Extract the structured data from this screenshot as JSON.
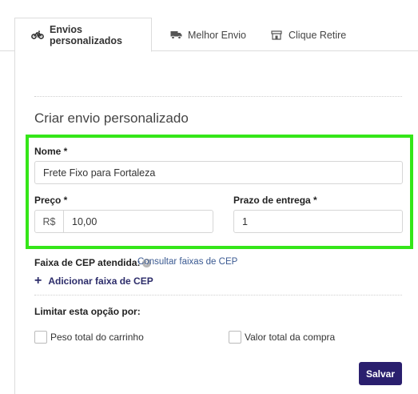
{
  "tabs": [
    {
      "label": "Envios personalizados",
      "icon": "motorcycle-icon",
      "active": true
    },
    {
      "label": "Melhor Envio",
      "icon": "truck-icon",
      "active": false
    },
    {
      "label": "Clique Retire",
      "icon": "store-icon",
      "active": false
    }
  ],
  "form": {
    "title": "Criar envio personalizado",
    "nome_label": "Nome *",
    "nome_value": "Frete Fixo para Fortaleza",
    "preco_label": "Preço *",
    "preco_prefix": "R$",
    "preco_value": "10,00",
    "prazo_label": "Prazo de entrega *",
    "prazo_value": "1",
    "cep_label": "Faixa de CEP atendida:",
    "cep_link": "Consultar faixas de CEP",
    "add_cep": "Adicionar faixa de CEP",
    "limitar_label": "Limitar esta opção por:",
    "peso_label": "Peso total do carrinho",
    "valor_label": "Valor total da compra",
    "save_label": "Salvar"
  },
  "colors": {
    "highlight": "#35e619",
    "save_button": "#2a1f6e",
    "link": "#3b5a92"
  }
}
